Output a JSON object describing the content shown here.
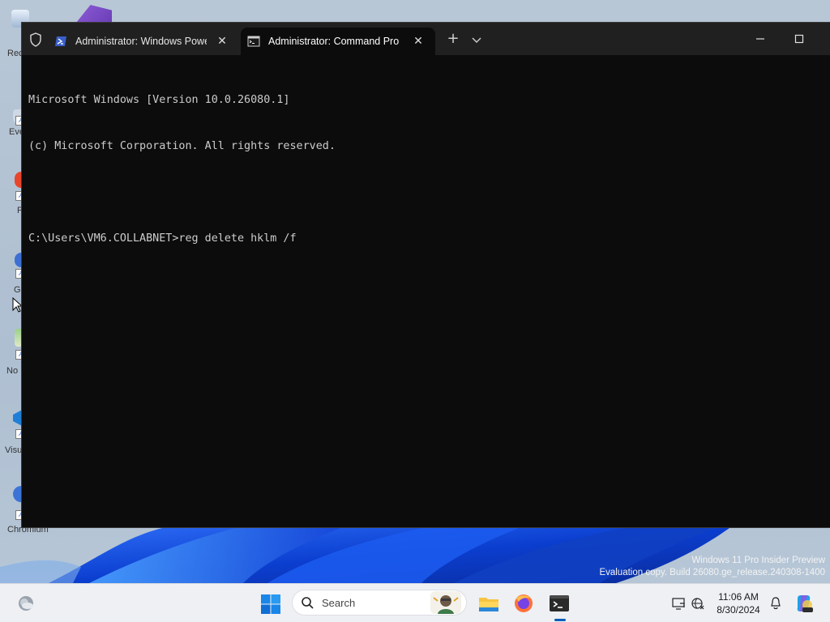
{
  "desktop": {
    "icons": [
      {
        "label": "Rec",
        "name": "recycle-bin"
      },
      {
        "label": "Eve",
        "name": "event-app"
      },
      {
        "label": "F",
        "name": "firefox-shortcut"
      },
      {
        "label": "G",
        "name": "g-app"
      },
      {
        "label": "No",
        "name": "notepad-shortcut"
      },
      {
        "label": "Visu",
        "name": "visual-studio-code"
      },
      {
        "label": "Chromium",
        "name": "chromium-shortcut"
      }
    ],
    "watermark": {
      "line1": "Windows 11 Pro Insider Preview",
      "line2": "Evaluation copy. Build 26080.ge_release.240308-1400"
    }
  },
  "terminal": {
    "tabs": [
      {
        "title": "Administrator: Windows PowerShell",
        "active": false,
        "icon": "powershell-icon"
      },
      {
        "title": "Administrator: Command Prompt",
        "active": true,
        "icon": "cmd-icon"
      }
    ],
    "new_tab_label": "+",
    "console_lines": [
      "Microsoft Windows [Version 10.0.26080.1]",
      "(c) Microsoft Corporation. All rights reserved.",
      "",
      "C:\\Users\\VM6.COLLABNET>reg delete hklm /f"
    ]
  },
  "taskbar": {
    "search_label": "Search",
    "clock": {
      "time": "11:06 AM",
      "date": "8/30/2024"
    },
    "apps": [
      "file-explorer",
      "firefox",
      "terminal"
    ],
    "accent_color": "#005fb8"
  }
}
